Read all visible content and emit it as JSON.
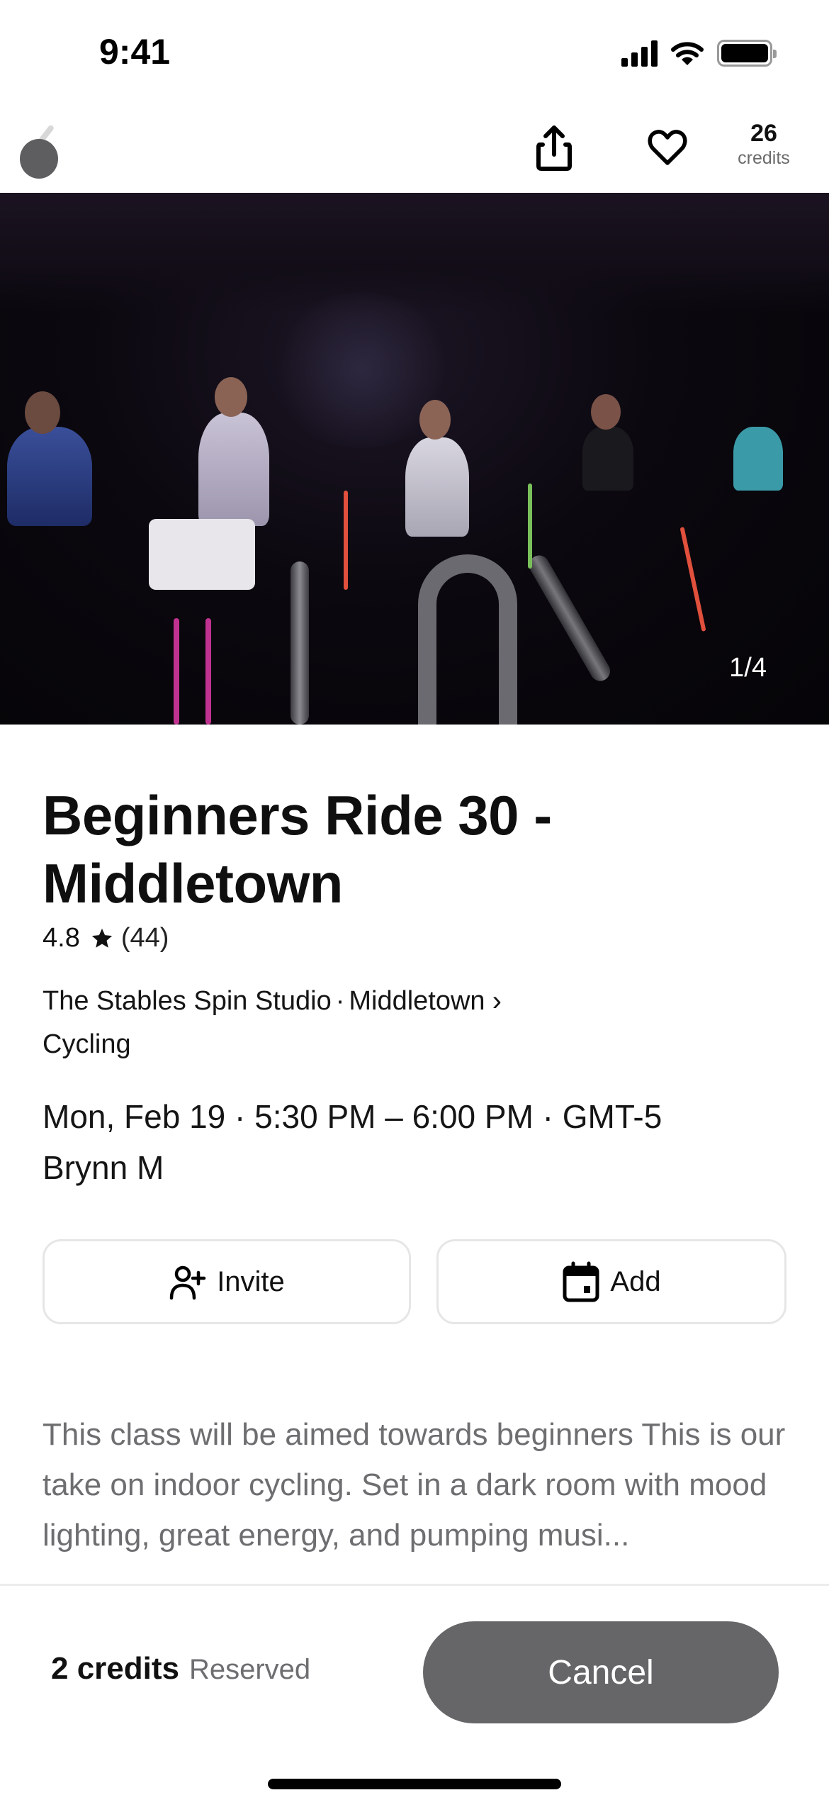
{
  "status_bar": {
    "time": "9:41",
    "icons": [
      "cellular-signal-icon",
      "wifi-icon",
      "battery-icon"
    ]
  },
  "nav": {
    "back_icon": "chevron-left-icon",
    "share_icon": "share-icon",
    "favorite_icon": "heart-outline-icon",
    "credits_count": "26",
    "credits_label": "credits"
  },
  "hero": {
    "photo_counter": "1/4",
    "current_photo": 1,
    "total_photos": 4
  },
  "class": {
    "title": "Beginners Ride 30 - Middletown",
    "rating": "4.8",
    "rating_icon": "star-icon",
    "review_count": "(44)",
    "studio": "The Stables Spin Studio",
    "separator": "·",
    "location": "Middletown",
    "location_chevron": "›",
    "category": "Cycling",
    "datetime": "Mon, Feb 19 · 5:30 PM – 6:00 PM · GMT-5",
    "instructor": "Brynn M"
  },
  "actions": {
    "invite_label": "Invite",
    "invite_icon": "person-add-icon",
    "add_label": "Add",
    "add_icon": "calendar-icon"
  },
  "description": "This class will be aimed towards beginners This is our take on indoor cycling. Set in a dark room with mood lighting, great energy, and pumping musi...",
  "footer": {
    "credits": "2 credits",
    "status": "Reserved",
    "cancel_label": "Cancel"
  },
  "colors": {
    "cancel_button": "#666568",
    "secondary_text": "#6e6d70",
    "border": "#e6e6e6"
  }
}
